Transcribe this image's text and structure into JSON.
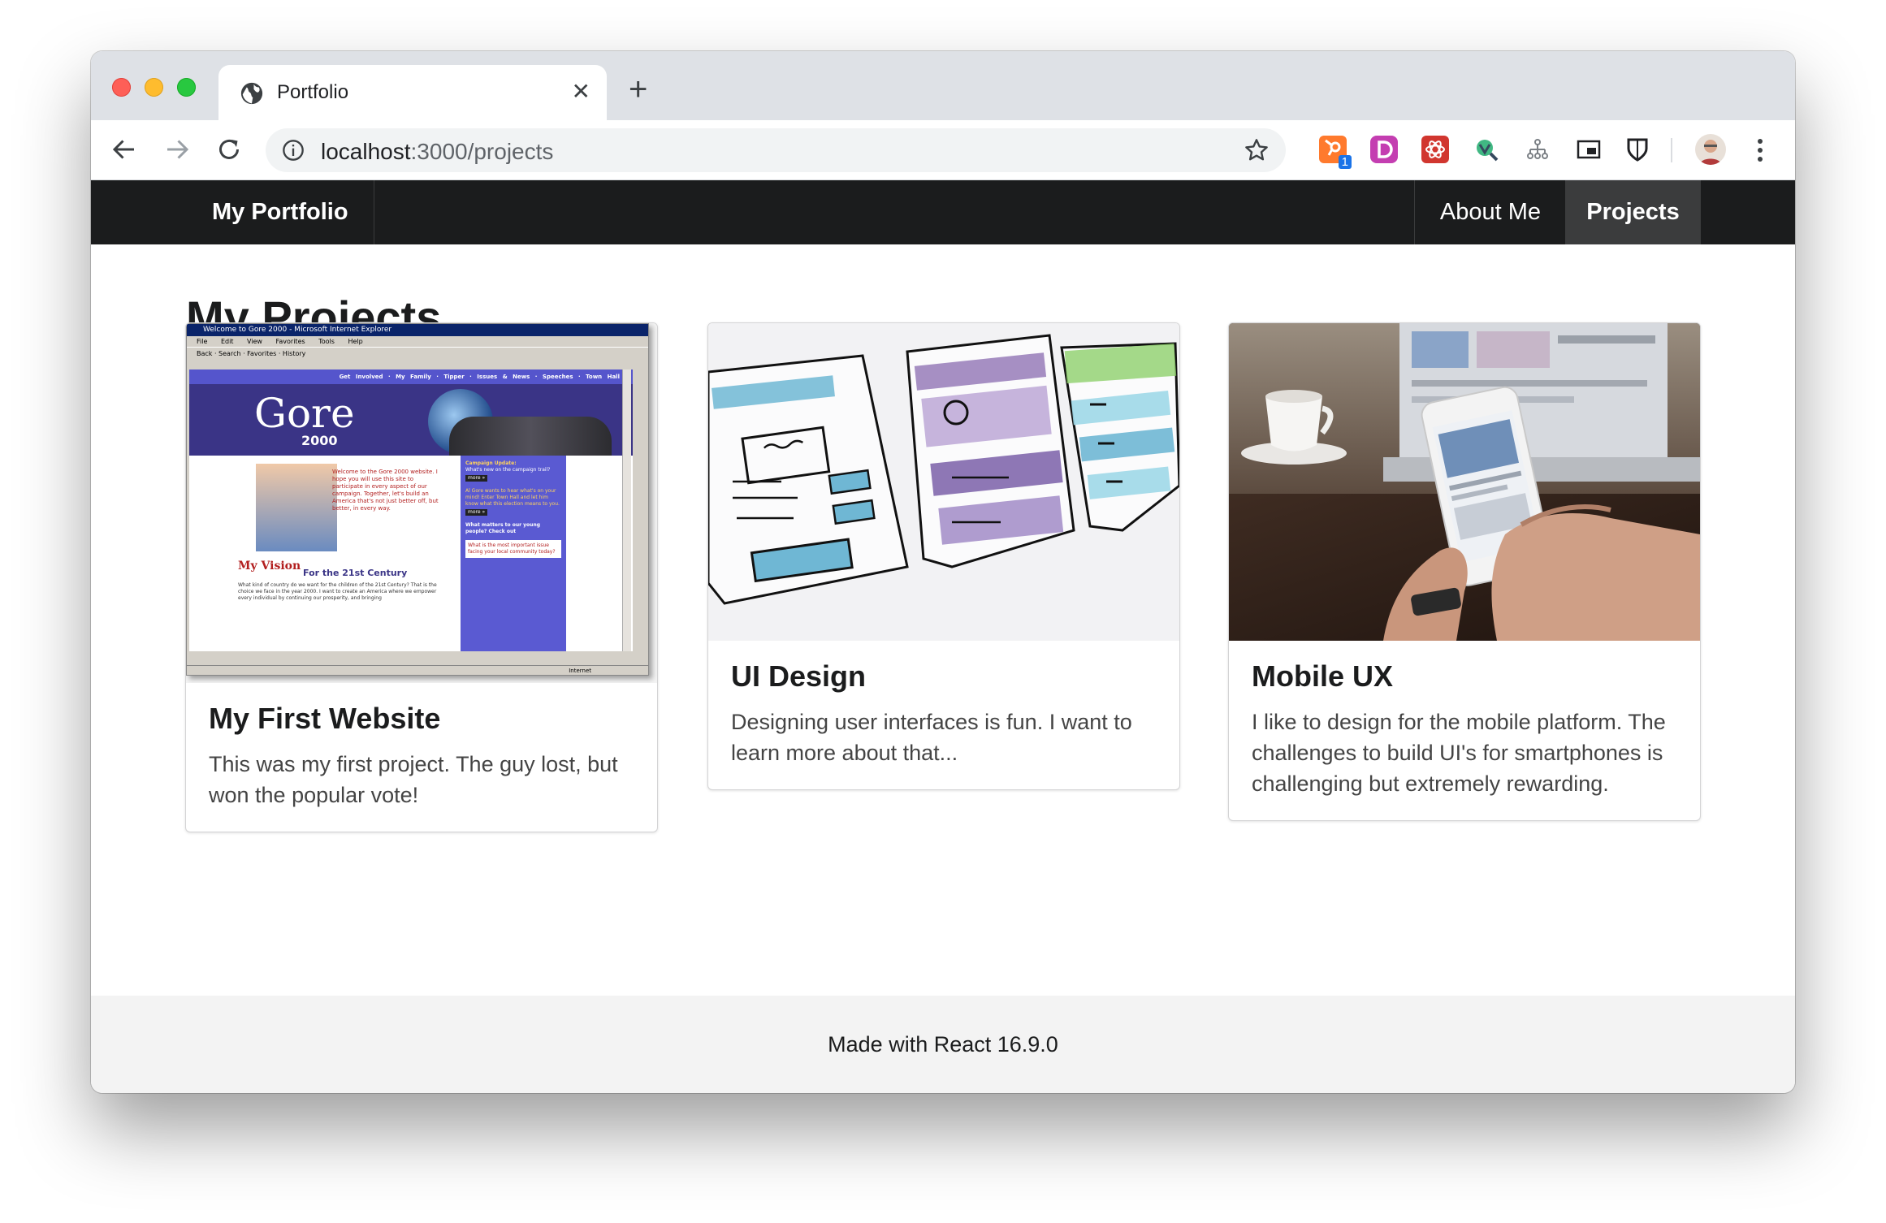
{
  "browser": {
    "tab_title": "Portfolio",
    "url_host": "localhost",
    "url_rest": ":3000/projects",
    "extension_badge": "1"
  },
  "site": {
    "brand": "My Portfolio",
    "nav": [
      {
        "label": "About Me",
        "active": false
      },
      {
        "label": "Projects",
        "active": true
      }
    ]
  },
  "main": {
    "title": "My Projects",
    "cards": [
      {
        "title": "My First Website",
        "description": "This was my first project. The guy lost, but won the popular vote!",
        "image": {
          "browser_title": "Welcome to Gore 2000 - Microsoft Internet Explorer",
          "menu": [
            "File",
            "Edit",
            "View",
            "Favorites",
            "Tools",
            "Help"
          ],
          "toolbar_text": "Back · Search · Favorites · History",
          "site_nav": [
            "Get Involved",
            "My Family",
            "Tipper",
            "Issues & News",
            "Speeches",
            "Town Hall"
          ],
          "logo_text": "Gore",
          "logo_year": "2000",
          "welcome_text": "Welcome to the Gore 2000 website. I hope you will use this site to participate in every aspect of our campaign. Together, let's build an America that's not just better off, but better, in every way.",
          "vision_heading": "My Vision",
          "vision_sub": "For the 21st Century",
          "vision_body": "What kind of country do we want for the children of the 21st Century? That is the choice we face in the year 2000. I want to create an America where we empower every individual by continuing our prosperity, and bringing",
          "sidebar_1_title": "Campaign Update:",
          "sidebar_1_text": "What's new on the campaign trail?",
          "sidebar_2_text": "Al Gore wants to hear what's on your mind! Enter Town Hall and let him know what this election means to you.",
          "sidebar_3_text": "What matters to our young people? Check out",
          "sidebar_4_text": "What is the most important issue facing your local community today?",
          "more_label": "more »",
          "status_text": "Internet"
        }
      },
      {
        "title": "UI Design",
        "description": "Designing user interfaces is fun. I want to learn more about that..."
      },
      {
        "title": "Mobile UX",
        "description": "I like to design for the mobile platform. The challenges to build UI's for smartphones is challenging but extremely rewarding."
      }
    ]
  },
  "footer": {
    "text": "Made with React 16.9.0"
  },
  "colors": {
    "navbar": "#1b1c1d",
    "nav_active": "#3b3c3d",
    "gore_purple": "#3a3486",
    "gore_blue": "#5a5ad2"
  }
}
